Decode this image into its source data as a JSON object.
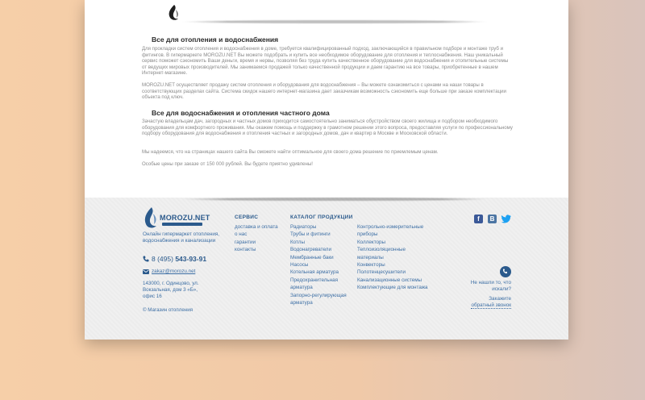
{
  "content": {
    "section1": {
      "title": "Все для отопления и водоснабжения",
      "p1": "Для прокладки систем отопления и водоснабжения в доме, требуется квалифицированный подход, заключающийся в правильном подборе и монтаже труб и фитингов. В гипермаркете MOROZU.NET Вы можете подобрать и купить все необходимое оборудование для отопления и теплоснабжения. Наш уникальный сервис поможет сэкономить Ваши деньги, время и нервы, позволяя без труда купить качественное оборудование для водоснабжения и отопительные системы от ведущих мировых производителей. Мы занимаемся продажей только качественной продукции и даем гарантию на все товары, приобретенные в нашем Интернет-магазине.",
      "p2": "MOROZU.NET осуществляет продажу систем отопления и оборудования для водоснабжения – Вы можете ознакомиться с ценами на наши товары в соответствующих разделах сайта. Система скидок нашего интернет-магазина дает заказчикам возможность сэкономить еще больше при заказе комплектации объекта под ключ."
    },
    "section2": {
      "title": "Все для водоснабжения и отопления частного дома",
      "p1": "Зачастую владельцам дач, загородных и частных домов приходится самостоятельно заниматься обустройством своего жилища и подбором необходимого оборудования для комфортного проживания. Мы окажем помощь и поддержку в грамотном решении этого вопроса, предоставляя услуги по профессиональному подбору оборудования для водоснабжения и отопления частных и загородных домов, дач и квартир в Москве и Московской области.",
      "p2": "Мы надеемся, что на страницах нашего сайта Вы сможете найти оптимальное для своего дома решение по приемлемым ценам.",
      "p3": "Особые цены при заказе от 150 000 рублей. Вы будете приятно удивлены!"
    }
  },
  "footer": {
    "logo_text": "MOROZU.NET",
    "tagline": "Онлайн гипермаркет отопления, водоснабжения и канализации",
    "phone_prefix": "8 (495)",
    "phone_number": "543-93-91",
    "email": "zakaz@morozu.net",
    "address": "143000, г. Одинцово, ул. Вокзальная, дом 3 «Б», офис 16",
    "copyright": "© Магазин отопления",
    "service": {
      "title": "СЕРВИС",
      "items": [
        "доставка и оплата",
        "о нас",
        "гарантии",
        "контакты"
      ]
    },
    "catalog": {
      "title": "КАТАЛОГ ПРОДУКЦИИ",
      "col1": [
        "Радиаторы",
        "Трубы и фитинги",
        "Котлы",
        "Водонагреватели",
        "Мембранные баки",
        "Насосы",
        "Котельная арматура",
        "Предохранительная арматура",
        "Запорно-регулирующая арматура"
      ],
      "col2": [
        "Контрольно-измерительные приборы",
        "Коллекторы",
        "Теплоизоляционные материалы",
        "Конвекторы",
        "Полотенцесушители",
        "Канализационные системы",
        "Комплектующие для монтажа"
      ]
    },
    "social": {
      "facebook": "f",
      "vkontakte": "В",
      "twitter": "t"
    },
    "help_text": "Не нашли то, что искали?",
    "callback_line1": "Закажите",
    "callback_line2": "обратный звонок"
  },
  "colors": {
    "link": "#3d6fa5",
    "brand": "#2b5a8c",
    "facebook": "#3b5998",
    "vkontakte": "#4c75a3",
    "twitter": "#1da1f2"
  }
}
